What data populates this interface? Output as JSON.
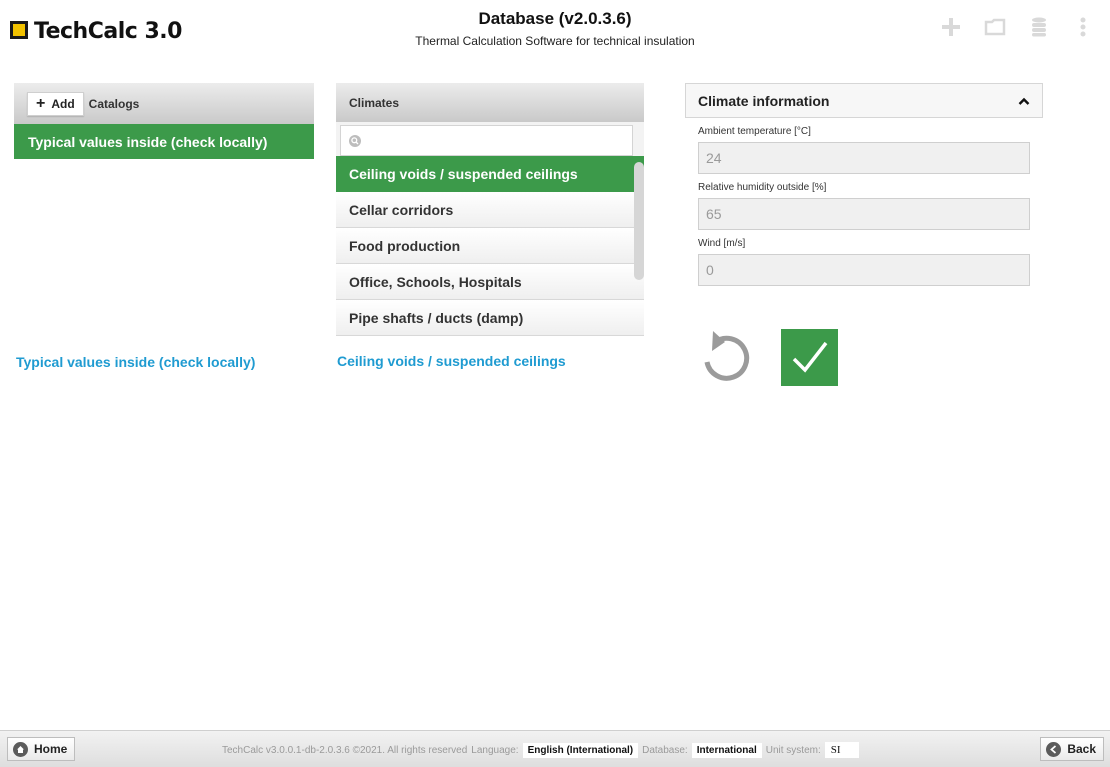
{
  "app": {
    "logo_text": "TechCalc 3.0",
    "title": "Database (v2.0.3.6)",
    "subtitle": "Thermal Calculation Software for technical insulation",
    "accent_color": "#3c9a4a",
    "link_color": "#1f9bd1"
  },
  "toolbar_icons": [
    "plus-icon",
    "folder-icon",
    "database-icon",
    "more-vertical-icon"
  ],
  "catalogs": {
    "add_label": "Add",
    "header": "Catalogs",
    "items": [
      {
        "label": "Typical values inside (check locally)",
        "selected": true
      }
    ],
    "selected_label": "Typical values inside (check locally)"
  },
  "climates": {
    "header": "Climates",
    "search_placeholder": "",
    "items": [
      {
        "label": "Ceiling voids / suspended ceilings",
        "selected": true
      },
      {
        "label": "Cellar corridors",
        "selected": false
      },
      {
        "label": "Food production",
        "selected": false
      },
      {
        "label": "Office, Schools, Hospitals",
        "selected": false
      },
      {
        "label": "Pipe shafts / ducts (damp)",
        "selected": false
      }
    ],
    "selected_label": "Ceiling voids / suspended ceilings"
  },
  "climate_info": {
    "header": "Climate information",
    "fields": [
      {
        "label": "Ambient temperature [°C]",
        "value": "24"
      },
      {
        "label": "Relative humidity outside [%]",
        "value": "65"
      },
      {
        "label": "Wind [m/s]",
        "value": "0"
      }
    ]
  },
  "footer": {
    "home_label": "Home",
    "back_label": "Back",
    "version_text": "TechCalc v3.0.0.1-db-2.0.3.6 ©2021. All rights reserved",
    "language_label": "Language:",
    "language_value": "English (International)",
    "database_label": "Database:",
    "database_value": "International",
    "unit_label": "Unit system:",
    "unit_value": "SI"
  }
}
